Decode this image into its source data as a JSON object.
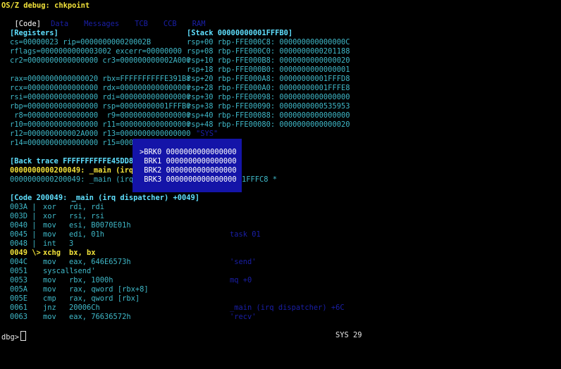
{
  "title": "OS/Z debug: chkpoint",
  "tabs": [
    {
      "label": "[Code]",
      "active": true
    },
    {
      "label": "Data",
      "active": false
    },
    {
      "label": "Messages",
      "active": false
    },
    {
      "label": "TCB",
      "active": false
    },
    {
      "label": "CCB",
      "active": false
    },
    {
      "label": "RAM",
      "active": false
    }
  ],
  "registers": {
    "heading": "[Registers]",
    "lines": [
      "cs=00000023 rip=000000000020002B",
      "rflags=0000000000003002 excerr=00000000",
      "cr2=0000000000000000 cr3=000000000002A000",
      "",
      "rax=0000000000000020 rbx=FFFFFFFFFFE391B8",
      "rcx=0000000000000000 rdx=0000000000000000",
      "rsi=0000000000000000 rdi=0000000000000000",
      "rbp=0000000000000000 rsp=00000000001FFFB0",
      " r8=0000000000000000  r9=0000000000000000",
      "r10=0000000000000000 r11=0000000000000000",
      "r12=000000000002A000 r13=0000000000000000",
      "r14=0000000000000000 r15=0000000000000000"
    ]
  },
  "stack": {
    "heading": "[Stack 00000000001FFFB0]",
    "lines": [
      "rsp+00 rbp-FFE000C8: 000000000000000C",
      "rsp+08 rbp-FFE000C0: 0000000000201188",
      "rsp+10 rbp-FFE000B8: 0000000000000020",
      "rsp+18 rbp-FFE000B0: 0000000000000001",
      "rsp+20 rbp-FFE000A8: 00000000001FFFD8",
      "rsp+28 rbp-FFE000A0: 00000000001FFFE8",
      "rsp+30 rbp-FFE00098: 0000000000000000",
      "rsp+38 rbp-FFE00090: 0000000000535953",
      "rsp+40 rbp-FFE00088: 0000000000000000",
      "rsp+48 rbp-FFE00080: 0000000000000020"
    ],
    "note": "\"SYS\""
  },
  "backtrace": {
    "heading": "[Back trace FFFFFFFFFFE45DD8]",
    "line1": "0000000000200049: _main (irq",
    "line2": "0000000000200049: _main (irq",
    "line2_tail": "1FFFC8 *"
  },
  "popup": {
    "rows": [
      ">BRK0 0000000000000000",
      " BRK1 0000000000000000",
      " BRK2 0000000000000000",
      " BRK3 0000000000000000"
    ]
  },
  "code": {
    "heading": "[Code 200049: _main (irq dispatcher) +0049]",
    "lines": [
      {
        "addr": "003A |",
        "op": "xor",
        "args": "rdi, rdi",
        "comment": "",
        "current": false
      },
      {
        "addr": "003D |",
        "op": "xor",
        "args": "rsi, rsi",
        "comment": "",
        "current": false
      },
      {
        "addr": "0040 |",
        "op": "mov",
        "args": "esi, B0070E01h",
        "comment": "",
        "current": false
      },
      {
        "addr": "0045 |",
        "op": "mov",
        "args": "edi, 01h",
        "comment": "task 01",
        "current": false
      },
      {
        "addr": "0048 |",
        "op": "int",
        "args": "3",
        "comment": "",
        "current": false
      },
      {
        "addr": "0049 \\>",
        "op": "xchg",
        "args": "bx, bx",
        "comment": "",
        "current": true
      },
      {
        "addr": "004C",
        "op": "mov",
        "args": "eax, 646E6573h",
        "comment": "'send'",
        "current": false
      },
      {
        "addr": "0051",
        "op": "syscall",
        "args": "'send'",
        "comment": "",
        "current": false
      },
      {
        "addr": "0053",
        "op": "mov",
        "args": "rbx, 1000h",
        "comment": "mq +0",
        "current": false
      },
      {
        "addr": "005A",
        "op": "mov",
        "args": "rax, qword [rbx+8]",
        "comment": "",
        "current": false
      },
      {
        "addr": "005E",
        "op": "cmp",
        "args": "rax, qword [rbx]",
        "comment": "",
        "current": false
      },
      {
        "addr": "0061",
        "op": "jnz",
        "args": "20006Ch",
        "comment": "_main (irq dispatcher) +6C",
        "current": false
      },
      {
        "addr": "0063",
        "op": "mov",
        "args": "eax, 76636572h",
        "comment": "'recv'",
        "current": false
      }
    ]
  },
  "prompt": "dbg>",
  "status": "SYS 29"
}
